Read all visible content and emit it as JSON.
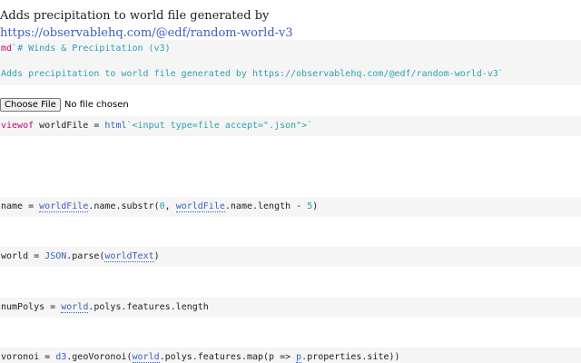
{
  "intro": {
    "text": "Adds precipitation to world file generated by",
    "link": "https://observablehq.com/@edf/random-world-v3"
  },
  "cells": {
    "md": {
      "line1_kw": "md",
      "line1_str": "`# Winds & Precipitation (v3)",
      "line2_str": "Adds precipitation to world file generated by https://observablehq.com/@edf/random-world-v3`"
    },
    "worldfile": {
      "kw": "viewof",
      "name": " worldFile = ",
      "tag": "html",
      "str": "`<input type=file accept=\".json\">`"
    },
    "name": {
      "a": "name = ",
      "ref1": "worldFile",
      "b": ".name.substr(",
      "n1": "0",
      "c": ", ",
      "ref2": "worldFile",
      "d": ".name.length - ",
      "n2": "5",
      "e": ")"
    },
    "world": {
      "a": "world = ",
      "fn": "JSON",
      "b": ".parse(",
      "ref": "worldText",
      "c": ")"
    },
    "numpolys": {
      "a": "numPolys = ",
      "ref": "world",
      "b": ".polys.features.length"
    },
    "voronoi": {
      "a": "voronoi = ",
      "fn": "d3",
      "b": ".geoVoronoi(",
      "ref": "world",
      "c": ".polys.features.map(p => ",
      "ref2": "p",
      "d": ".properties.site))"
    }
  },
  "file_input": {
    "button_label": "Choose File",
    "status": "No file chosen"
  }
}
